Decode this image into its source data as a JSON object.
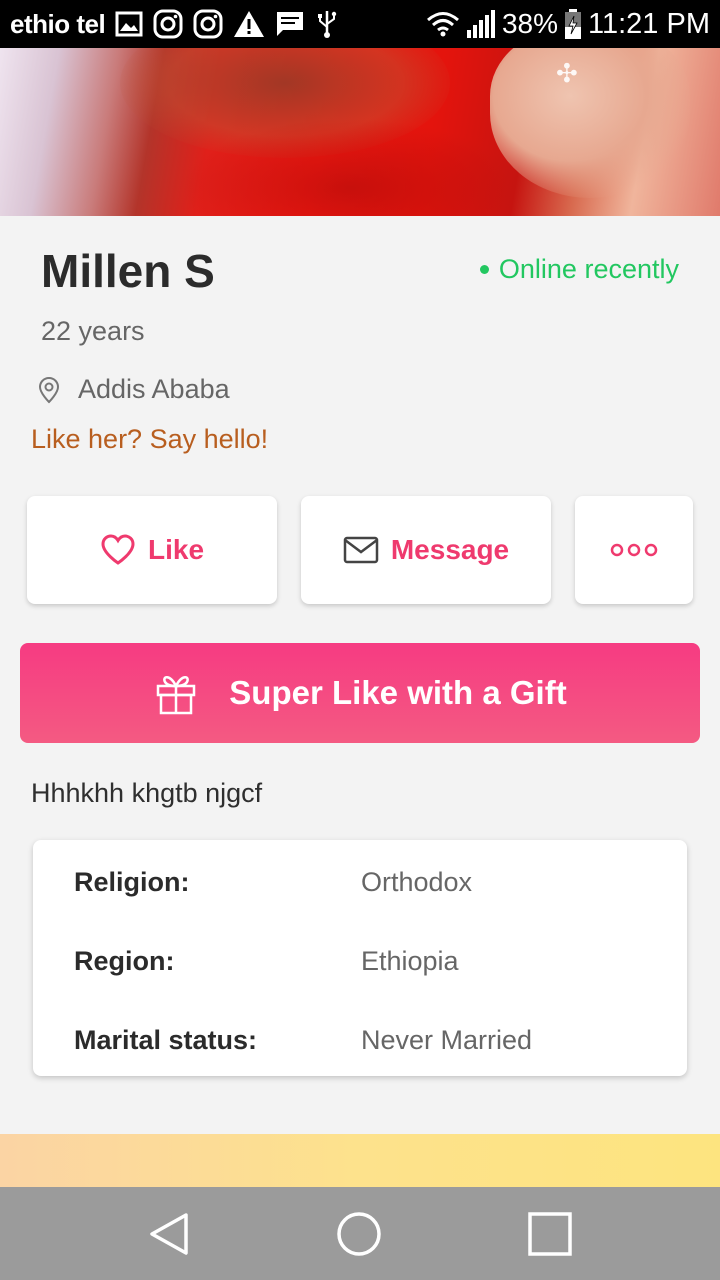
{
  "status_bar": {
    "carrier": "ethio tel",
    "battery": "38%",
    "time": "11:21 PM"
  },
  "profile": {
    "name": "Millen S",
    "online_status": "Online recently",
    "age": "22 years",
    "location": "Addis Ababa",
    "prompt": "Like her? Say hello!",
    "bio": "Hhhkhh khgtb njgcf"
  },
  "actions": {
    "like_label": "Like",
    "message_label": "Message",
    "gift_label": "Super Like with a Gift"
  },
  "details": [
    {
      "label": "Religion:",
      "value": "Orthodox"
    },
    {
      "label": "Region:",
      "value": "Ethiopia"
    },
    {
      "label": "Marital status:",
      "value": "Never Married"
    }
  ],
  "colors": {
    "accent": "#ef3a6e",
    "online": "#22c760",
    "prompt": "#b85e1f"
  }
}
